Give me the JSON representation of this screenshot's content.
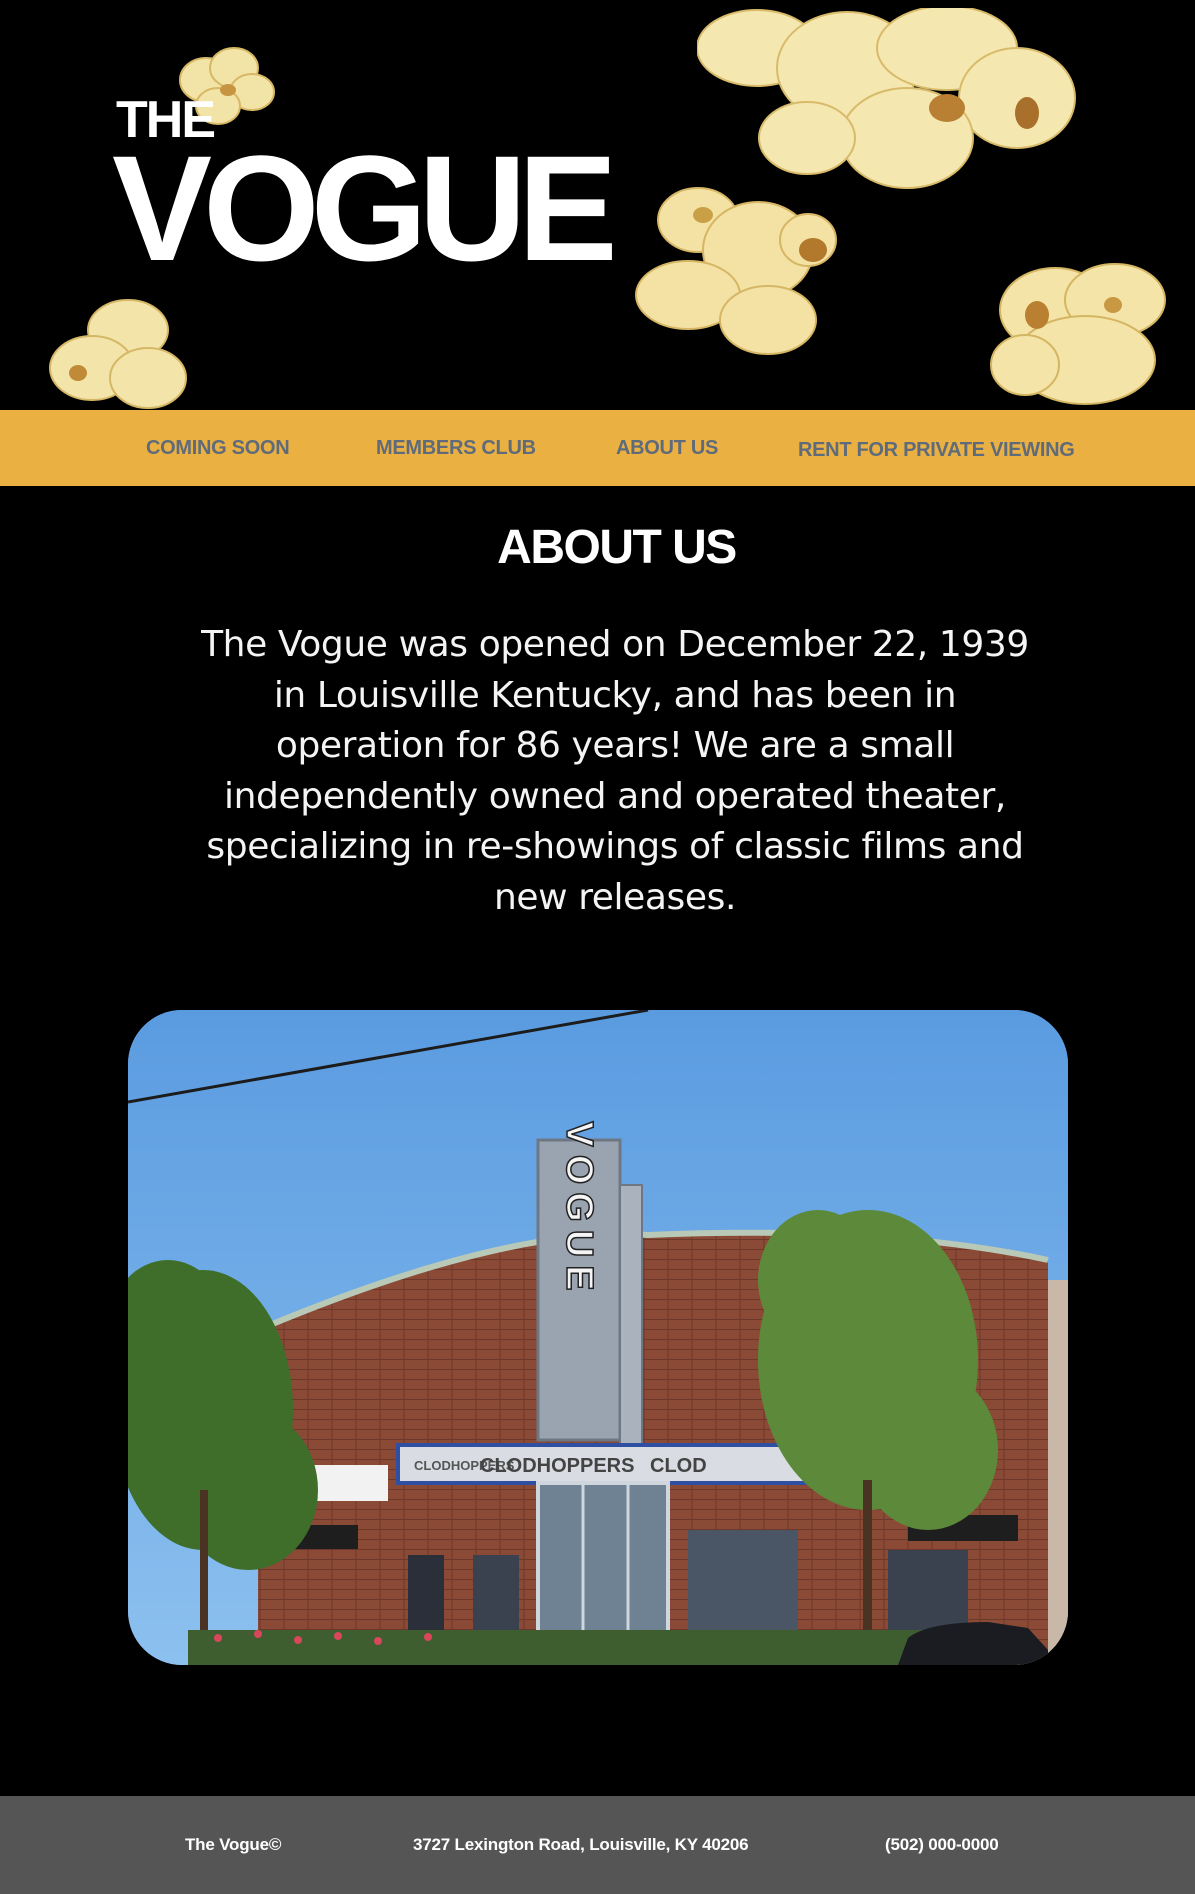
{
  "brand": {
    "the": "THE",
    "vogue": "VOGUE"
  },
  "nav": [
    {
      "label": "COMING SOON"
    },
    {
      "label": "MEMBERS CLUB"
    },
    {
      "label": "ABOUT US"
    },
    {
      "label": "RENT FOR PRIVATE VIEWING"
    }
  ],
  "about": {
    "title": "ABOUT US",
    "body": "The Vogue was opened on December 22, 1939 in Louisville Kentucky, and has been in operation for 86 years! We are a small independently owned and operated theater, specializing in re-showings of classic films and new releases."
  },
  "photo": {
    "marquee_sign": "VOGUE",
    "marquee_board": "CLODHOPPERS",
    "marquee_board_repeat": "CLOD",
    "marquee_small": "CLODHOPPERS"
  },
  "footer": {
    "name": "The Vogue©",
    "address": "3727 Lexington Road, Louisville, KY 40206",
    "phone": "(502) 000-0000"
  },
  "colors": {
    "background": "#000000",
    "nav_bar": "#eab142",
    "nav_text": "#5f6b7a",
    "footer": "#555555",
    "sky": "#6ca8e6",
    "brick": "#8a4a36"
  }
}
